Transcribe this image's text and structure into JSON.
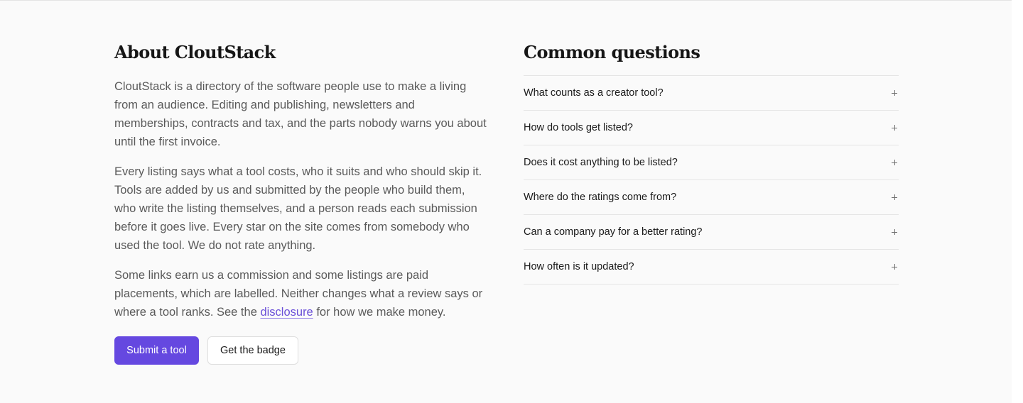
{
  "about": {
    "heading": "About CloutStack",
    "paragraph1": "CloutStack is a directory of the software people use to make a living from an audience. Editing and publishing, newsletters and memberships, contracts and tax, and the parts nobody warns you about until the first invoice.",
    "paragraph2": "Every listing says what a tool costs, who it suits and who should skip it. Tools are added by us and submitted by the people who build them, who write the listing themselves, and a person reads each submission before it goes live. Every star on the site comes from somebody who used the tool. We do not rate anything.",
    "paragraph3_before": "Some links earn us a commission and some listings are paid placements, which are labelled. Neither changes what a review says or where a tool ranks. See the ",
    "paragraph3_link": "disclosure",
    "paragraph3_after": " for how we make money."
  },
  "actions": {
    "submit_label": "Submit a tool",
    "badge_label": "Get the badge"
  },
  "faq": {
    "heading": "Common questions",
    "items": [
      {
        "question": "What counts as a creator tool?",
        "icon": "plus-icon"
      },
      {
        "question": "How do tools get listed?",
        "icon": "plus-icon"
      },
      {
        "question": "Does it cost anything to be listed?",
        "icon": "plus-icon"
      },
      {
        "question": "Where do the ratings come from?",
        "icon": "plus-icon"
      },
      {
        "question": "Can a company pay for a better rating?",
        "icon": "plus-icon"
      },
      {
        "question": "How often is it updated?",
        "icon": "plus-icon"
      }
    ]
  },
  "colors": {
    "accent": "#6548e0",
    "link": "#6a4fd8",
    "background": "#fafafa",
    "body_text": "#5a5a5a"
  }
}
